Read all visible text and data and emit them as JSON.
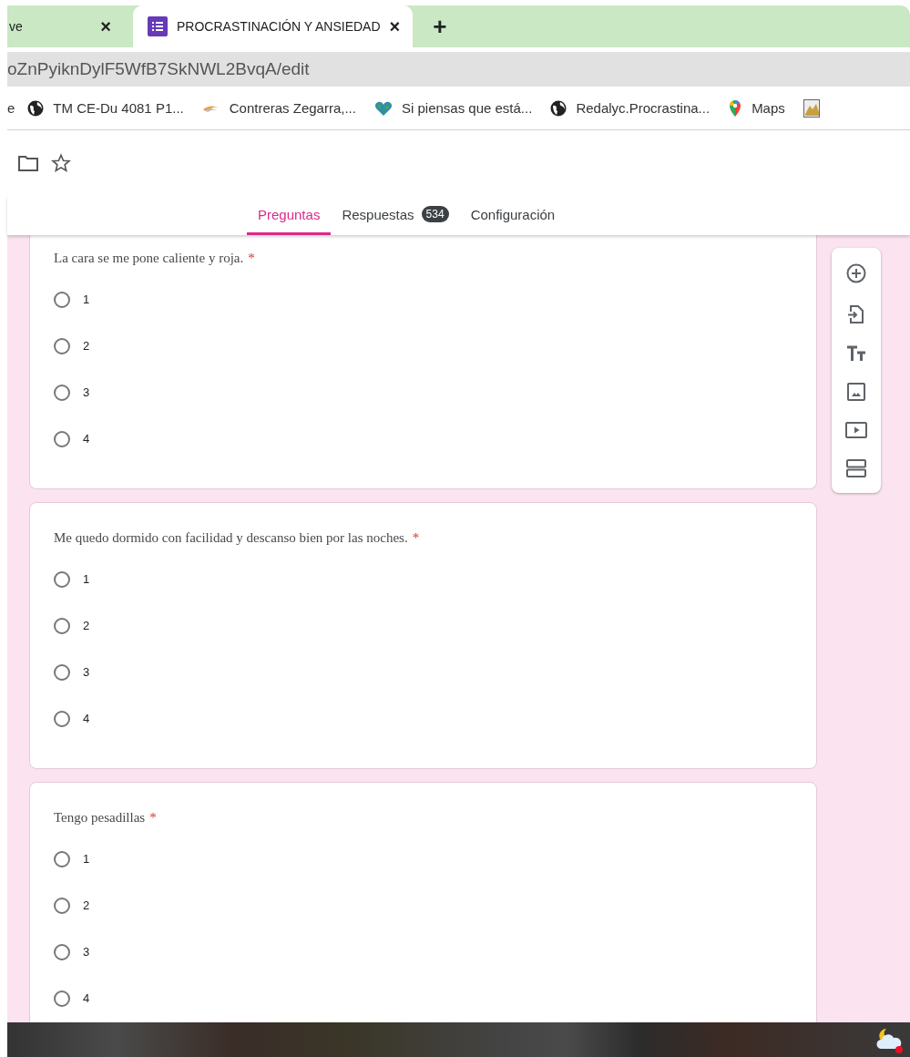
{
  "browser_tabs": [
    {
      "title": "ve",
      "selected": false
    },
    {
      "title": "PROCRASTINACIÓN Y ANSIEDAD",
      "selected": true
    }
  ],
  "new_tab": "+",
  "close_mark": "×",
  "address_bar": {
    "url": "oZnPyiknDylF5WfB7SkNWL2BvqA/edit"
  },
  "bookmarks": [
    {
      "label": "e",
      "kind": "none"
    },
    {
      "label": "TM CE-Du 4081 P1...",
      "kind": "globe"
    },
    {
      "label": "Contreras Zegarra,...",
      "kind": "swoosh"
    },
    {
      "label": "Si piensas que está...",
      "kind": "heart"
    },
    {
      "label": "Redalyc.Procrastina...",
      "kind": "globe"
    },
    {
      "label": "Maps",
      "kind": "pin"
    },
    {
      "kind": "image"
    }
  ],
  "form_tabs": [
    {
      "label": "Preguntas",
      "selected": true
    },
    {
      "label": "Respuestas",
      "selected": false,
      "badge": "534"
    },
    {
      "label": "Configuración",
      "selected": false
    }
  ],
  "questions": [
    {
      "text": "La cara se me pone caliente y roja.",
      "required_mark": "*",
      "options": [
        {
          "label": "1",
          "selected": false
        },
        {
          "label": "2",
          "selected": false
        },
        {
          "label": "3",
          "selected": false
        },
        {
          "label": "4",
          "selected": false
        }
      ]
    },
    {
      "text": "Me quedo dormido con facilidad y descanso bien por las noches.",
      "required_mark": "*",
      "options": [
        {
          "label": "1",
          "selected": false
        },
        {
          "label": "2",
          "selected": false
        },
        {
          "label": "3",
          "selected": false
        },
        {
          "label": "4",
          "selected": false
        }
      ]
    },
    {
      "text": "Tengo pesadillas",
      "required_mark": "*",
      "options": [
        {
          "label": "1",
          "selected": false
        },
        {
          "label": "2",
          "selected": false
        },
        {
          "label": "3",
          "selected": false
        },
        {
          "label": "4",
          "selected": false
        }
      ]
    }
  ]
}
